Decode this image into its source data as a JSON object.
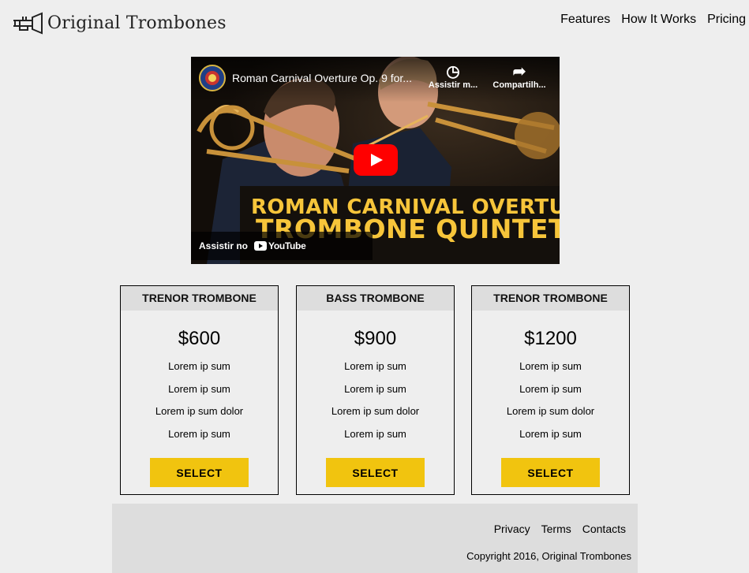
{
  "brand": {
    "name": "Original Trombones",
    "logo_icon": "trombone-icon"
  },
  "nav": {
    "items": [
      {
        "label": "Features"
      },
      {
        "label": "How It Works"
      },
      {
        "label": "Pricing"
      }
    ]
  },
  "video": {
    "title": "Roman Carnival Overture Op. 9 for...",
    "watch_later_label": "Assistir m...",
    "share_label": "Compartilh...",
    "banner_line1": "ROMAN CARNIVAL OVERTURE",
    "banner_line2": "TROMBONE QUINTET",
    "watch_on_label": "Assistir no",
    "platform_label": "YouTube",
    "icons": {
      "clock": "clock-icon",
      "share": "share-icon",
      "play": "play-icon"
    }
  },
  "plans": [
    {
      "name": "TRENOR TROMBONE",
      "price": "$600",
      "features": [
        "Lorem ip sum",
        "Lorem ip sum",
        "Lorem ip sum dolor",
        "Lorem ip sum"
      ],
      "button": "SELECT"
    },
    {
      "name": "BASS TROMBONE",
      "price": "$900",
      "features": [
        "Lorem ip sum",
        "Lorem ip sum",
        "Lorem ip sum dolor",
        "Lorem ip sum"
      ],
      "button": "SELECT"
    },
    {
      "name": "TRENOR TROMBONE",
      "price": "$1200",
      "features": [
        "Lorem ip sum",
        "Lorem ip sum",
        "Lorem ip sum dolor",
        "Lorem ip sum"
      ],
      "button": "SELECT"
    }
  ],
  "footer": {
    "links": [
      {
        "label": "Privacy"
      },
      {
        "label": "Terms"
      },
      {
        "label": "Contacts"
      }
    ],
    "copyright": "Copyright 2016, Original Trombones"
  },
  "colors": {
    "background": "#eeeeee",
    "card_header": "#dddddd",
    "footer_bg": "#dddddd",
    "button": "#f1c40f",
    "banner_text": "#f7c53a",
    "play_button": "#ff0000"
  }
}
